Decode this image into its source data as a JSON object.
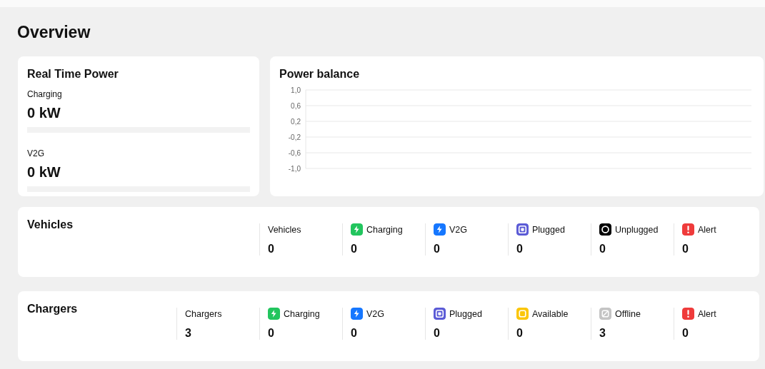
{
  "title": "Overview",
  "real_time_power": {
    "title": "Real Time Power",
    "meters": [
      {
        "label": "Charging",
        "reading": "0 kW",
        "level": 0
      },
      {
        "label": "V2G",
        "reading": "0 kW",
        "level": 0
      }
    ]
  },
  "power_balance": {
    "title": "Power balance",
    "y_axis_labels": [
      "1,0",
      "0,6",
      "0,2",
      "-0,2",
      "-0,6",
      "-1,0"
    ]
  },
  "sections": [
    {
      "title": "Vehicles",
      "stats": [
        {
          "kind": "total",
          "label": "Vehicles",
          "value": "0"
        },
        {
          "kind": "charging",
          "label": "Charging",
          "value": "0",
          "color": "#22c55e"
        },
        {
          "kind": "v2g",
          "label": "V2G",
          "value": "0",
          "color": "#1677ff"
        },
        {
          "kind": "plugged",
          "label": "Plugged",
          "value": "0",
          "color": "#5b5bd6"
        },
        {
          "kind": "unplugged",
          "label": "Unplugged",
          "value": "0",
          "color": "#000000"
        },
        {
          "kind": "alert",
          "label": "Alert",
          "value": "0",
          "color": "#ef3b3b"
        }
      ]
    },
    {
      "title": "Chargers",
      "stats": [
        {
          "kind": "total",
          "label": "Chargers",
          "value": "3"
        },
        {
          "kind": "charging",
          "label": "Charging",
          "value": "0",
          "color": "#22c55e"
        },
        {
          "kind": "v2g",
          "label": "V2G",
          "value": "0",
          "color": "#1677ff"
        },
        {
          "kind": "plugged",
          "label": "Plugged",
          "value": "0",
          "color": "#5b5bd6"
        },
        {
          "kind": "available",
          "label": "Available",
          "value": "0",
          "color": "#fbc60a"
        },
        {
          "kind": "offline",
          "label": "Offline",
          "value": "3",
          "color": "#c4c4c4"
        },
        {
          "kind": "alert",
          "label": "Alert",
          "value": "0",
          "color": "#ef3b3b"
        }
      ]
    }
  ]
}
